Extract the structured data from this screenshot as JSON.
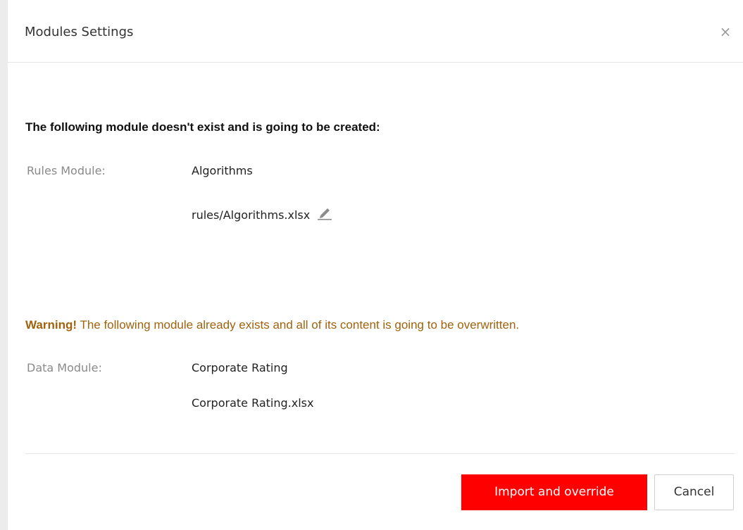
{
  "dialog": {
    "title": "Modules Settings",
    "close_glyph": "×"
  },
  "create_section": {
    "heading": "The following module doesn't exist and is going to be created:",
    "label": "Rules Module:",
    "module_name": "Algorithms",
    "file_name": "rules/Algorithms.xlsx",
    "edit_icon": "pencil-icon"
  },
  "overwrite_section": {
    "warning_strong": "Warning!",
    "warning_text": " The following module already exists and all of its content is going to be overwritten.",
    "label": "Data Module:",
    "module_name": "Corporate Rating",
    "file_name": "Corporate Rating.xlsx"
  },
  "footer": {
    "primary_label": "Import and override",
    "secondary_label": "Cancel"
  },
  "colors": {
    "primary": "#ff0000",
    "warning": "#a0620d",
    "label": "#8a8a8a"
  }
}
